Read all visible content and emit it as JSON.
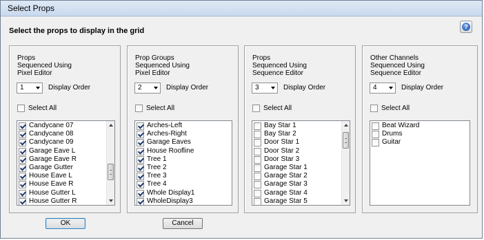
{
  "window": {
    "title": "Select Props"
  },
  "instruction": "Select the props to display in the grid",
  "help_icon": "question-mark",
  "panels": [
    {
      "title_lines": [
        "Props",
        "Sequenced Using",
        "Pixel Editor"
      ],
      "order_value": "1",
      "display_order_label": "Display Order",
      "select_all_label": "Select All",
      "items": [
        {
          "label": "Candycane 07",
          "checked": true
        },
        {
          "label": "Candycane 08",
          "checked": true
        },
        {
          "label": "Candycane 09",
          "checked": true
        },
        {
          "label": "Garage Eave L",
          "checked": true
        },
        {
          "label": "Garage Eave R",
          "checked": true
        },
        {
          "label": "Garage Gutter",
          "checked": true
        },
        {
          "label": "House Eave L",
          "checked": true
        },
        {
          "label": "House Eave R",
          "checked": true
        },
        {
          "label": "House Gutter L",
          "checked": true
        },
        {
          "label": "House Gutter R",
          "checked": true
        }
      ]
    },
    {
      "title_lines": [
        "Prop Groups",
        "Sequenced Using",
        "Pixel Editor"
      ],
      "order_value": "2",
      "display_order_label": "Display Order",
      "select_all_label": "Select All",
      "items": [
        {
          "label": "Arches-Left",
          "checked": true
        },
        {
          "label": "Arches-Right",
          "checked": true
        },
        {
          "label": "Garage Eaves",
          "checked": true
        },
        {
          "label": "House Roofline",
          "checked": true
        },
        {
          "label": "Tree 1",
          "checked": true
        },
        {
          "label": "Tree 2",
          "checked": true
        },
        {
          "label": "Tree 3",
          "checked": true
        },
        {
          "label": "Tree 4",
          "checked": true
        },
        {
          "label": "Whole Display1",
          "checked": true
        },
        {
          "label": "WholeDisplay3",
          "checked": true
        }
      ]
    },
    {
      "title_lines": [
        "Props",
        "Sequenced Using",
        "Sequence Editor"
      ],
      "order_value": "3",
      "display_order_label": "Display Order",
      "select_all_label": "Select All",
      "items": [
        {
          "label": "Bay Star 1",
          "checked": false
        },
        {
          "label": "Bay Star 2",
          "checked": false
        },
        {
          "label": "Door Star 1",
          "checked": false
        },
        {
          "label": "Door Star 2",
          "checked": false
        },
        {
          "label": "Door Star 3",
          "checked": false
        },
        {
          "label": "Garage Star 1",
          "checked": false
        },
        {
          "label": "Garage Star 2",
          "checked": false
        },
        {
          "label": "Garage Star 3",
          "checked": false
        },
        {
          "label": "Garage Star 4",
          "checked": false
        },
        {
          "label": "Garage Star 5",
          "checked": false
        }
      ]
    },
    {
      "title_lines": [
        "Other Channels",
        "Sequenced Using",
        "Sequence Editor"
      ],
      "order_value": "4",
      "display_order_label": "Display Order",
      "select_all_label": "Select All",
      "items": [
        {
          "label": "Beat Wizard",
          "checked": false
        },
        {
          "label": "Drums",
          "checked": false
        },
        {
          "label": "Guitar",
          "checked": false
        }
      ]
    }
  ],
  "buttons": {
    "ok": "OK",
    "cancel": "Cancel"
  },
  "colors": {
    "default_button_border": "#3c7fb1",
    "check_mark": "#1f3a6a"
  }
}
